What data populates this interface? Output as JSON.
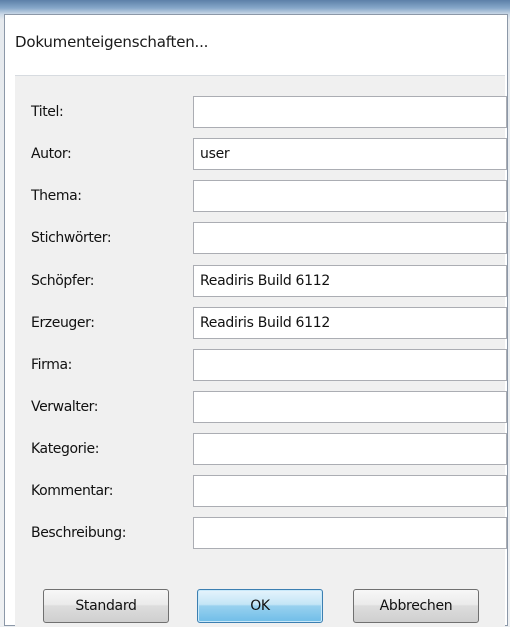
{
  "dialog": {
    "title": "Dokumenteigenschaften..."
  },
  "fields": [
    {
      "label": "Titel:",
      "value": ""
    },
    {
      "label": "Autor:",
      "value": "user"
    },
    {
      "label": "Thema:",
      "value": ""
    },
    {
      "label": "Stichwörter:",
      "value": ""
    },
    {
      "label": "Schöpfer:",
      "value": "Readiris Build 6112"
    },
    {
      "label": "Erzeuger:",
      "value": "Readiris Build 6112"
    },
    {
      "label": "Firma:",
      "value": ""
    },
    {
      "label": "Verwalter:",
      "value": ""
    },
    {
      "label": "Kategorie:",
      "value": ""
    },
    {
      "label": "Kommentar:",
      "value": ""
    },
    {
      "label": "Beschreibung:",
      "value": ""
    }
  ],
  "buttons": {
    "standard_label": "Standard",
    "ok_label": "OK",
    "cancel_label": "Abbrechen"
  }
}
